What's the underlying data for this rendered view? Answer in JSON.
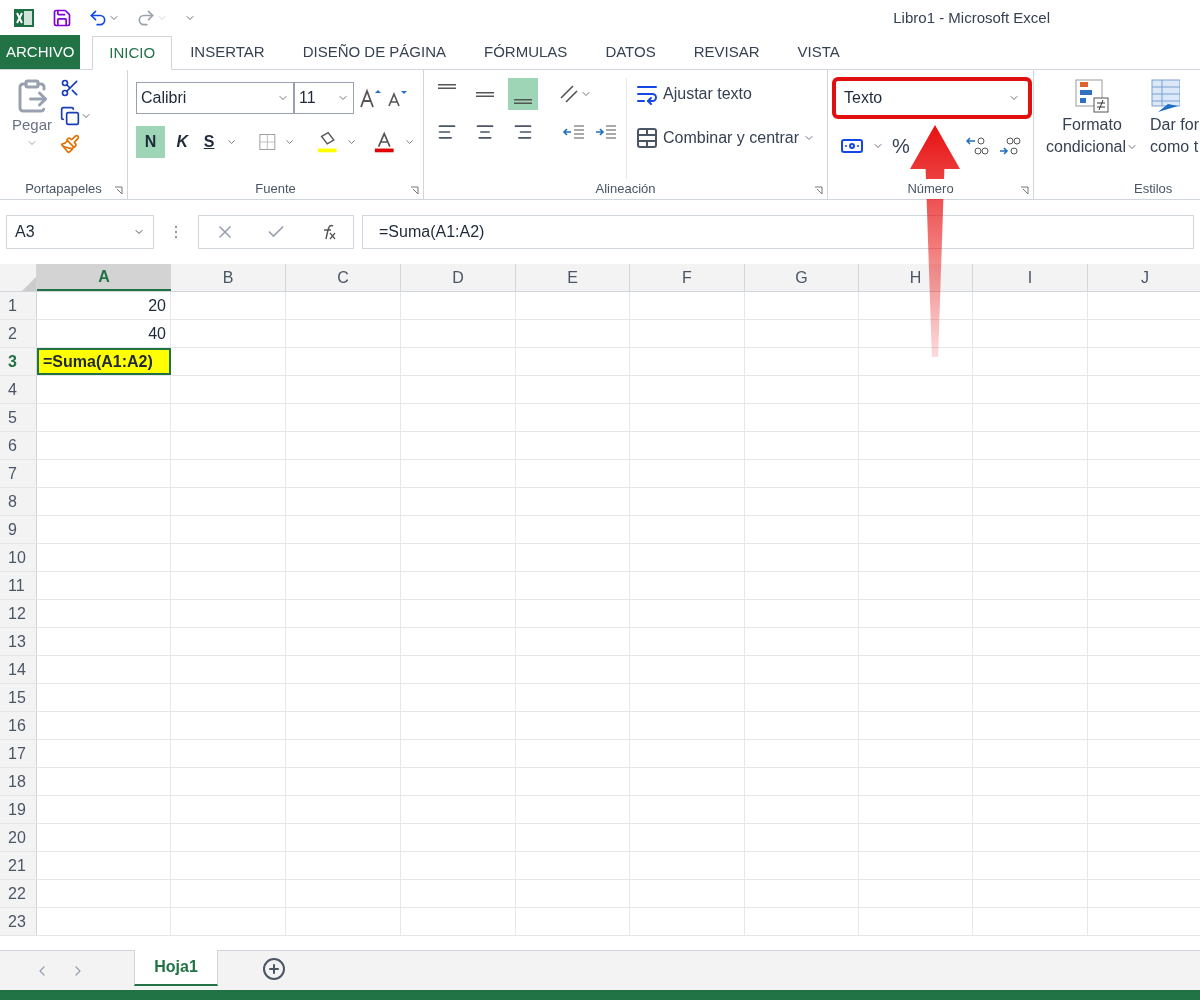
{
  "window": {
    "title": "Libro1 - Microsoft Excel"
  },
  "tabs": [
    {
      "label": "ARCHIVO",
      "kind": "file",
      "selected": false
    },
    {
      "label": "INICIO",
      "kind": "tab",
      "selected": true
    },
    {
      "label": "INSERTAR",
      "kind": "tab",
      "selected": false
    },
    {
      "label": "DISEÑO DE PÁGINA",
      "kind": "tab",
      "selected": false
    },
    {
      "label": "FÓRMULAS",
      "kind": "tab",
      "selected": false
    },
    {
      "label": "DATOS",
      "kind": "tab",
      "selected": false
    },
    {
      "label": "REVISAR",
      "kind": "tab",
      "selected": false
    },
    {
      "label": "VISTA",
      "kind": "tab",
      "selected": false
    }
  ],
  "ribbon": {
    "clipboard": {
      "paste_label": "Pegar",
      "group_label": "Portapapeles"
    },
    "font": {
      "font_name": "Calibri",
      "font_size": "11",
      "bold_label": "N",
      "italic_label": "K",
      "underline_label": "S",
      "bold": true,
      "group_label": "Fuente"
    },
    "alignment": {
      "vertical": [
        {
          "kind": "top",
          "selected": false
        },
        {
          "kind": "middle",
          "selected": false
        },
        {
          "kind": "bottom",
          "selected": true
        }
      ],
      "wrap_label": "Ajustar texto",
      "merge_label": "Combinar y centrar",
      "group_label": "Alineación"
    },
    "number": {
      "format": "Texto",
      "highlighted": true,
      "percent_label": "%",
      "group_label": "Número"
    },
    "styles": {
      "conditional_label_1": "Formato",
      "conditional_label_2": "condicional",
      "table_label_1": "Dar for",
      "table_label_2": "como t",
      "group_label": "Estilos"
    }
  },
  "formula_bar": {
    "name_box": "A3",
    "formula": "=Suma(A1:A2)"
  },
  "columns": [
    {
      "label": "A",
      "selected": true
    },
    {
      "label": "B",
      "selected": false
    },
    {
      "label": "C",
      "selected": false
    },
    {
      "label": "D",
      "selected": false
    },
    {
      "label": "E",
      "selected": false
    },
    {
      "label": "F",
      "selected": false
    },
    {
      "label": "G",
      "selected": false
    },
    {
      "label": "H",
      "selected": false
    },
    {
      "label": "I",
      "selected": false
    },
    {
      "label": "J",
      "selected": false
    }
  ],
  "rows": [
    {
      "label": "1",
      "selected": false,
      "cells": [
        {
          "value": "20",
          "selected": false
        }
      ]
    },
    {
      "label": "2",
      "selected": false,
      "cells": [
        {
          "value": "40",
          "selected": false
        }
      ]
    },
    {
      "label": "3",
      "selected": true,
      "cells": [
        {
          "value": "=Suma(A1:A2)",
          "selected": true,
          "color": "#ffff00"
        }
      ]
    },
    {
      "label": "4",
      "selected": false,
      "cells": []
    },
    {
      "label": "5",
      "selected": false,
      "cells": []
    },
    {
      "label": "6",
      "selected": false,
      "cells": []
    },
    {
      "label": "7",
      "selected": false,
      "cells": []
    },
    {
      "label": "8",
      "selected": false,
      "cells": []
    },
    {
      "label": "9",
      "selected": false,
      "cells": []
    },
    {
      "label": "10",
      "selected": false,
      "cells": []
    },
    {
      "label": "11",
      "selected": false,
      "cells": []
    },
    {
      "label": "12",
      "selected": false,
      "cells": []
    },
    {
      "label": "13",
      "selected": false,
      "cells": []
    },
    {
      "label": "14",
      "selected": false,
      "cells": []
    },
    {
      "label": "15",
      "selected": false,
      "cells": []
    },
    {
      "label": "16",
      "selected": false,
      "cells": []
    },
    {
      "label": "17",
      "selected": false,
      "cells": []
    },
    {
      "label": "18",
      "selected": false,
      "cells": []
    },
    {
      "label": "19",
      "selected": false,
      "cells": []
    },
    {
      "label": "20",
      "selected": false,
      "cells": []
    },
    {
      "label": "21",
      "selected": false,
      "cells": []
    },
    {
      "label": "22",
      "selected": false,
      "cells": []
    },
    {
      "label": "23",
      "selected": false,
      "cells": []
    }
  ],
  "sheets": [
    {
      "name": "Hoja1",
      "selected": true
    }
  ]
}
